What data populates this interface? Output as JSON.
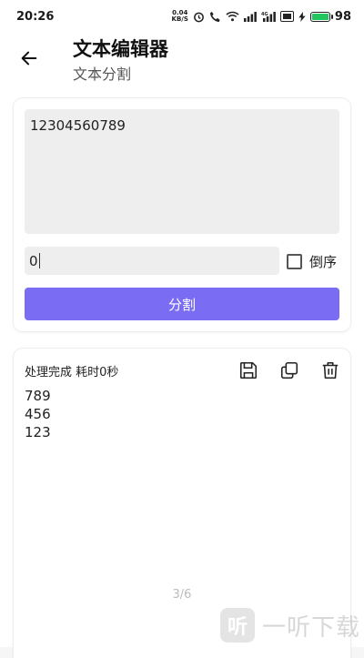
{
  "statusbar": {
    "time": "20:26",
    "netspeed_value": "0.04",
    "netspeed_unit": "KB/S",
    "battery": "98",
    "battery_level": 0.98,
    "network_label": "4G"
  },
  "header": {
    "title": "文本编辑器",
    "subtitle": "文本分割"
  },
  "editor": {
    "text_value": "12304560789",
    "separator_value": "0",
    "reverse_label": "倒序",
    "reverse_checked": false,
    "split_label": "分割"
  },
  "result": {
    "status": "处理完成 耗时0秒",
    "lines": [
      "789",
      "456",
      "123"
    ],
    "page_indicator": "3/6"
  },
  "watermark": {
    "text": "一听下载",
    "logo": "听"
  },
  "colors": {
    "accent": "#7a6cf3",
    "battery": "#22c55e"
  },
  "icons": {
    "back": "arrow-left-icon",
    "save": "save-icon",
    "copy": "copy-icon",
    "delete": "trash-icon"
  }
}
